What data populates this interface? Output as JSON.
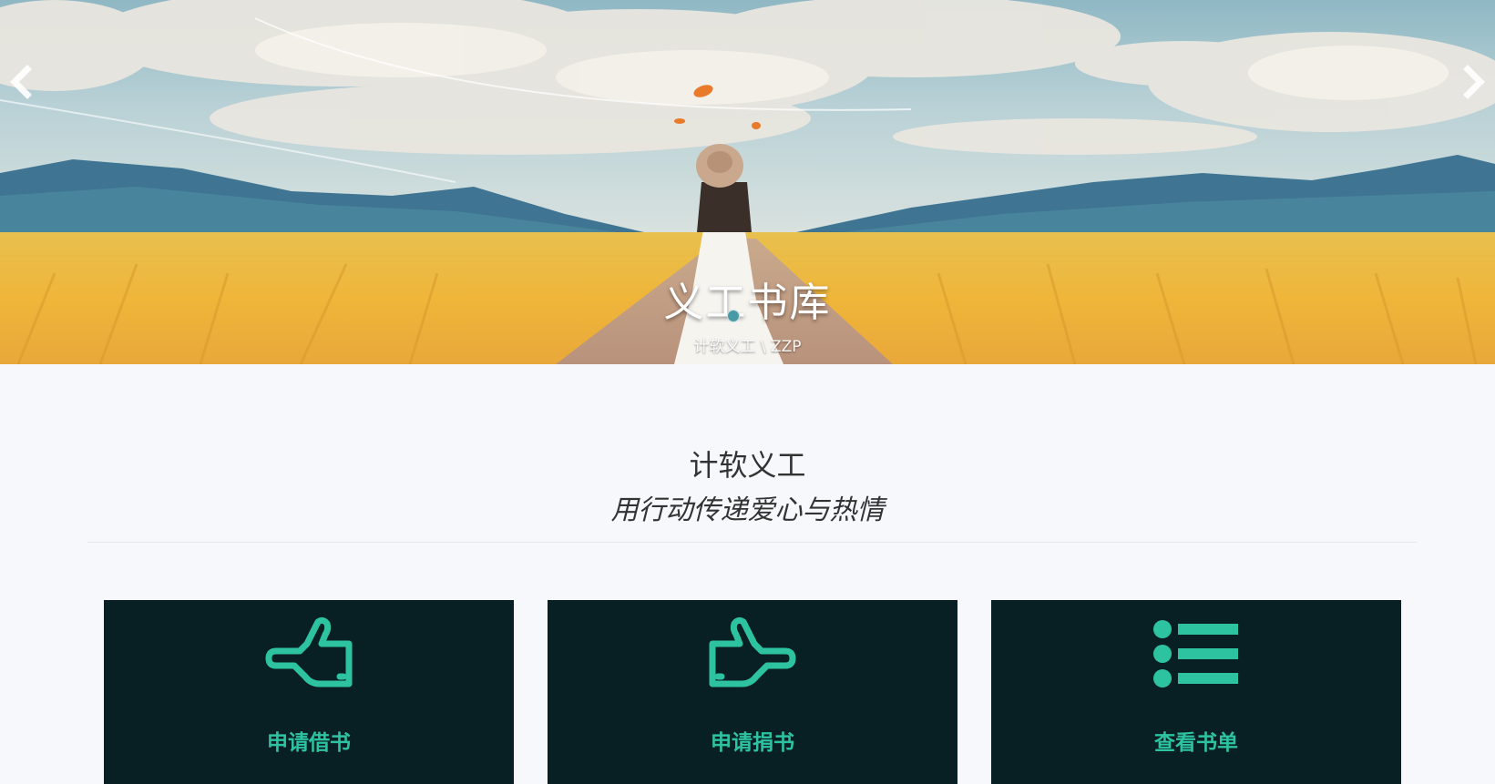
{
  "hero": {
    "title": "义工书库",
    "subtitle": "计软义工 \\ ZZP",
    "prev_icon": "chevron-left-icon",
    "next_icon": "chevron-right-icon"
  },
  "intro": {
    "title": "计软义工",
    "motto": "用行动传递爱心与热情"
  },
  "cards": [
    {
      "label": "申请借书",
      "icon": "hand-point-left-icon"
    },
    {
      "label": "申请捐书",
      "icon": "hand-point-right-icon"
    },
    {
      "label": "查看书单",
      "icon": "list-icon"
    }
  ],
  "colors": {
    "card_bg": "#081f24",
    "accent": "#2ec3a0",
    "page_bg": "#f7f8fc"
  }
}
